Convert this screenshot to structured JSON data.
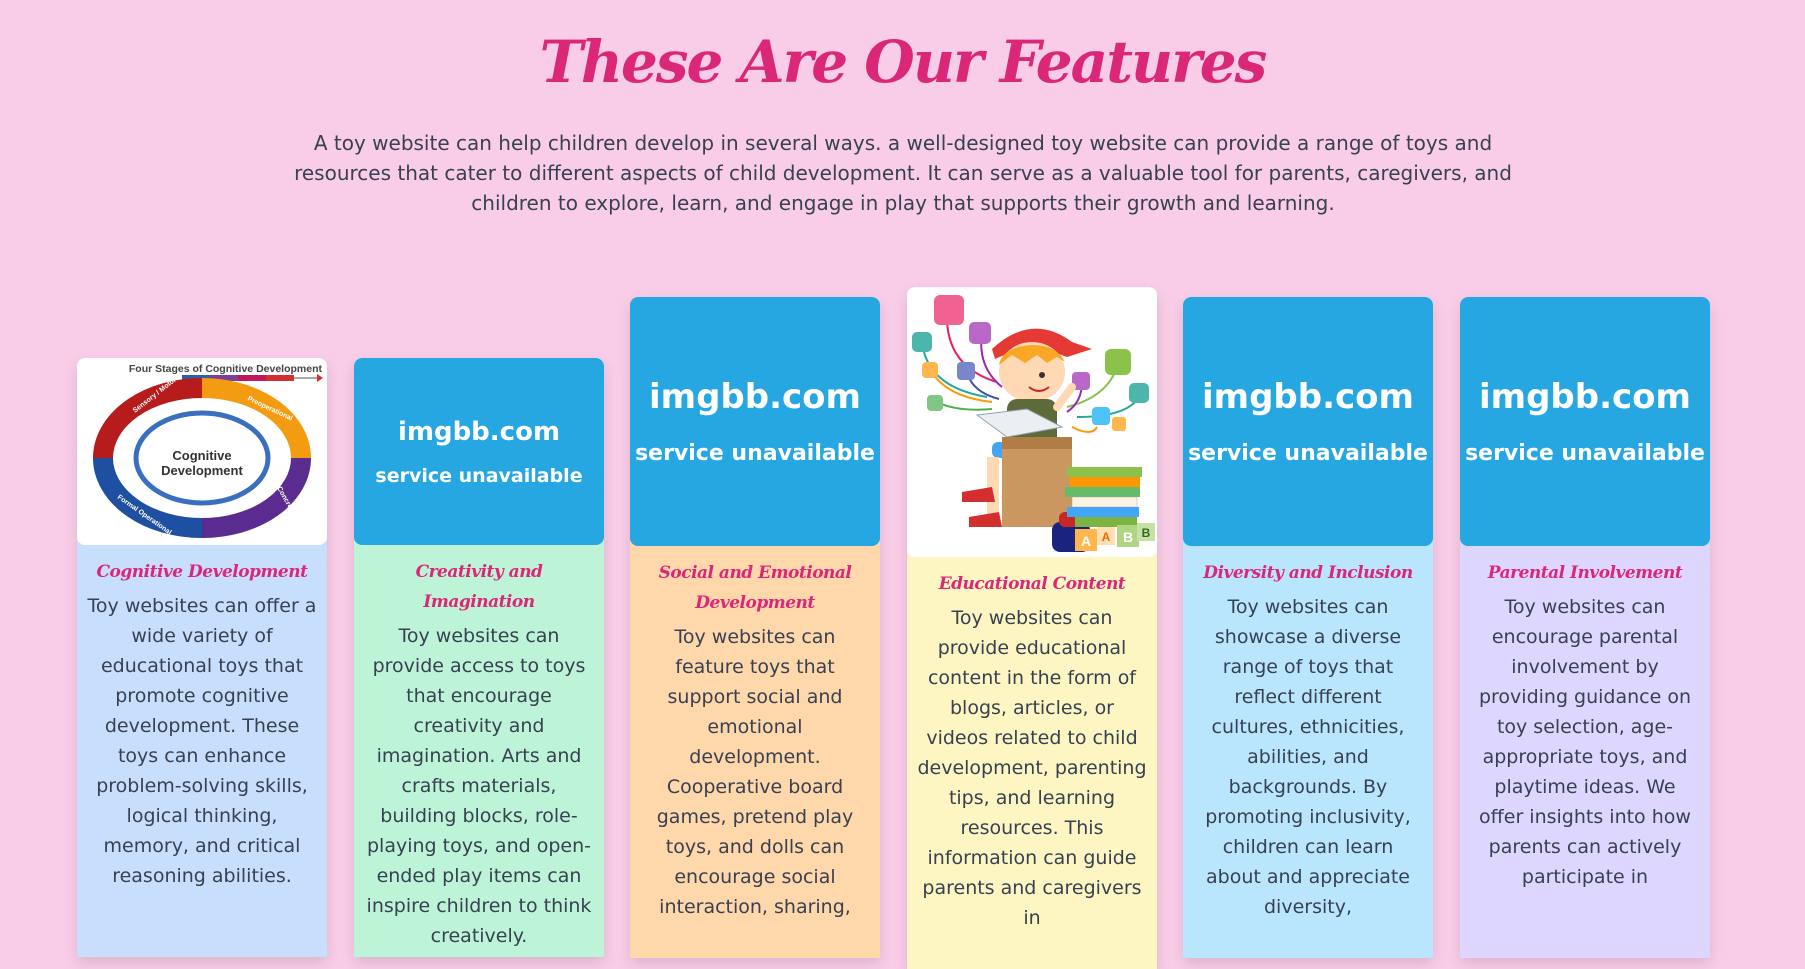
{
  "header": {
    "title": "These Are Our Features",
    "intro": "A toy website can help children develop in several ways. a well-designed toy website can provide a range of toys and resources that cater to different aspects of child development. It can serve as a valuable tool for parents, caregivers, and children to explore, learn, and engage in play that supports their growth and learning."
  },
  "cards": [
    {
      "title": "Cognitive Development",
      "text": "Toy websites can offer a wide variety of educational toys that promote cognitive development. These toys can enhance problem-solving skills, logical thinking, memory, and critical reasoning abilities.",
      "bg": "#c7defc",
      "image": {
        "kind": "diagram",
        "caption": "Four Stages of Cognitive Development",
        "center_line1": "Cognitive",
        "center_line2": "Development",
        "stages": [
          "Sensory / Motor",
          "Preoperational",
          "Concrete Operational",
          "Formal Operational"
        ]
      }
    },
    {
      "title": "Creativity and Imagination",
      "text": "Toy websites can provide access to toys that encourage creativity and imagination. Arts and crafts materials, building blocks, role-playing toys, and open-ended play items can inspire children to think creatively.",
      "bg": "#bdf4d7",
      "image": {
        "kind": "placeholder",
        "main": "imgbb.com",
        "sub": "service unavailable"
      }
    },
    {
      "title": "Social and Emotional Development",
      "text": "Toy websites can feature toys that support social and emotional development. Cooperative board games, pretend play toys, and dolls can encourage social interaction, sharing,",
      "bg": "#fed7aa",
      "image": {
        "kind": "placeholder",
        "main": "imgbb.com",
        "sub": "service unavailable"
      }
    },
    {
      "title": "Educational Content",
      "text": "Toy websites can provide educational content in the form of blogs, articles, or videos related to child development, parenting tips, and learning resources. This information can guide parents and caregivers in",
      "bg": "#fdf6c3",
      "image": {
        "kind": "illustration",
        "blocks": [
          "A",
          "A",
          "B",
          "B"
        ]
      }
    },
    {
      "title": "Diversity and Inclusion",
      "text": "Toy websites can showcase a diverse range of toys that reflect different cultures, ethnicities, abilities, and backgrounds. By promoting inclusivity, children can learn about and appreciate diversity,",
      "bg": "#bae6fd",
      "image": {
        "kind": "placeholder",
        "main": "imgbb.com",
        "sub": "service unavailable"
      }
    },
    {
      "title": "Parental Involvement",
      "text": "Toy websites can encourage parental involvement by providing guidance on toy selection, age-appropriate toys, and playtime ideas. We offer insights into how parents can actively participate in",
      "bg": "#ddd6fe",
      "image": {
        "kind": "placeholder",
        "main": "imgbb.com",
        "sub": "service unavailable"
      }
    }
  ]
}
